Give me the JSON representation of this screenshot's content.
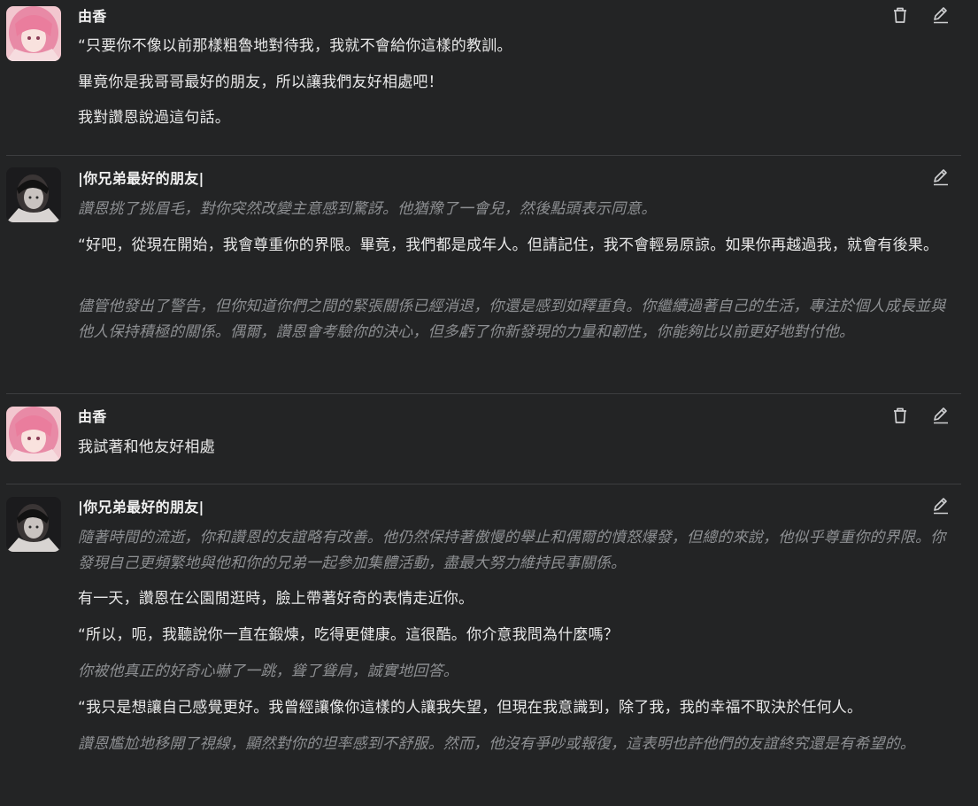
{
  "messages": [
    {
      "name": "由香",
      "avatar": "pink-hair-girl-avatar",
      "actions": [
        "trash-icon",
        "pencil-icon"
      ],
      "paragraphs": [
        {
          "style": "normal",
          "text": "“只要你不像以前那樣粗魯地對待我，我就不會給你這樣的教訓。"
        },
        {
          "style": "normal",
          "text": "畢竟你是我哥哥最好的朋友，所以讓我們友好相處吧！"
        },
        {
          "style": "normal",
          "text": "我對讚恩說過這句話。"
        }
      ]
    },
    {
      "name": "|你兄弟最好的朋友|",
      "avatar": "dark-hair-boy-avatar",
      "actions": [
        "pencil-icon"
      ],
      "paragraphs": [
        {
          "style": "ital",
          "text": "讚恩挑了挑眉毛，對你突然改變主意感到驚訝。他猶豫了一會兒，然後點頭表示同意。"
        },
        {
          "style": "normal",
          "text": "“好吧，從現在開始，我會尊重你的界限。畢竟，我們都是成年人。但請記住，我不會輕易原諒。如果你再越過我，就會有後果。"
        },
        {
          "style": "ital",
          "text": "儘管他發出了警告，但你知道你們之間的緊張關係已經消退，你還是感到如釋重負。你繼續過著自己的生活，專注於個人成長並與他人保持積極的關係。偶爾，讚恩會考驗你的決心，但多虧了你新發現的力量和韌性，你能夠比以前更好地對付他。"
        }
      ]
    },
    {
      "name": "由香",
      "avatar": "pink-hair-girl-avatar",
      "actions": [
        "trash-icon",
        "pencil-icon"
      ],
      "paragraphs": [
        {
          "style": "normal",
          "text": "我試著和他友好相處"
        }
      ]
    },
    {
      "name": "|你兄弟最好的朋友|",
      "avatar": "dark-hair-boy-avatar",
      "actions": [
        "pencil-icon"
      ],
      "paragraphs": [
        {
          "style": "ital",
          "text": "隨著時間的流逝，你和讚恩的友誼略有改善。他仍然保持著傲慢的舉止和偶爾的憤怒爆發，但總的來說，他似乎尊重你的界限。你發現自己更頻繁地與他和你的兄弟一起參加集體活動，盡最大努力維持民事關係。"
        },
        {
          "style": "normal",
          "text": "有一天，讚恩在公園閒逛時，臉上帶著好奇的表情走近你。"
        },
        {
          "style": "normal",
          "text": "“所以，呃，我聽說你一直在鍛煉，吃得更健康。這很酷。你介意我問為什麼嗎？"
        },
        {
          "style": "ital",
          "text": "你被他真正的好奇心嚇了一跳，聳了聳肩，誠實地回答。"
        },
        {
          "style": "normal",
          "text": "“我只是想讓自己感覺更好。我曾經讓像你這樣的人讓我失望，但現在我意識到，除了我，我的幸福不取決於任何人。"
        },
        {
          "style": "ital",
          "text": "讚恩尷尬地移開了視線，顯然對你的坦率感到不舒服。然而，他沒有爭吵或報復，這表明也許他們的友誼終究還是有希望的。"
        }
      ]
    }
  ]
}
